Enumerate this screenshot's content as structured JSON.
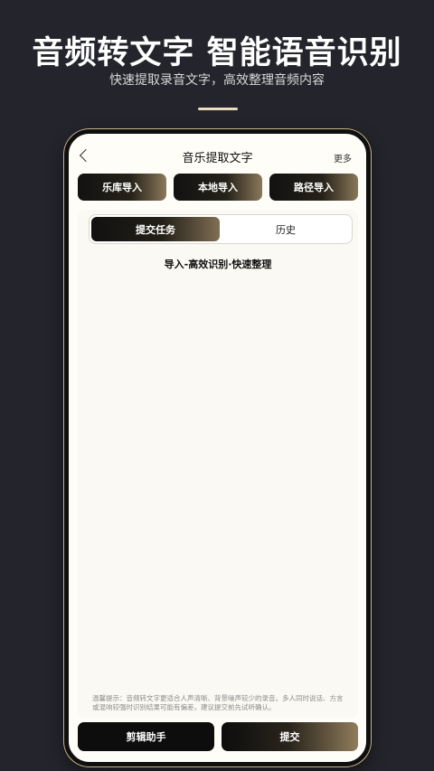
{
  "promo": {
    "title": "音频转文字 智能语音识别",
    "subtitle": "快速提取录音文字，高效整理音频内容"
  },
  "navbar": {
    "title": "音乐提取文字",
    "more": "更多",
    "back_icon": "chevron-left-icon"
  },
  "import_buttons": [
    {
      "label": "乐库导入"
    },
    {
      "label": "本地导入"
    },
    {
      "label": "路径导入"
    }
  ],
  "tabs": [
    {
      "label": "提交任务",
      "active": true
    },
    {
      "label": "历史",
      "active": false
    }
  ],
  "panel": {
    "heading": "导入-高效识别·快速整理",
    "tips": "温馨提示：音频转文字更适合人声清晰、背景噪声较少的录音。多人同时说话、方言或混响较强时识别结果可能有偏差，建议提交前先试听确认。"
  },
  "bottom_buttons": {
    "edit": "剪辑助手",
    "submit": "提交"
  },
  "colors": {
    "background": "#24252c",
    "accent_gold": "#8f7c5b",
    "phone_screen": "#fffdf8"
  }
}
